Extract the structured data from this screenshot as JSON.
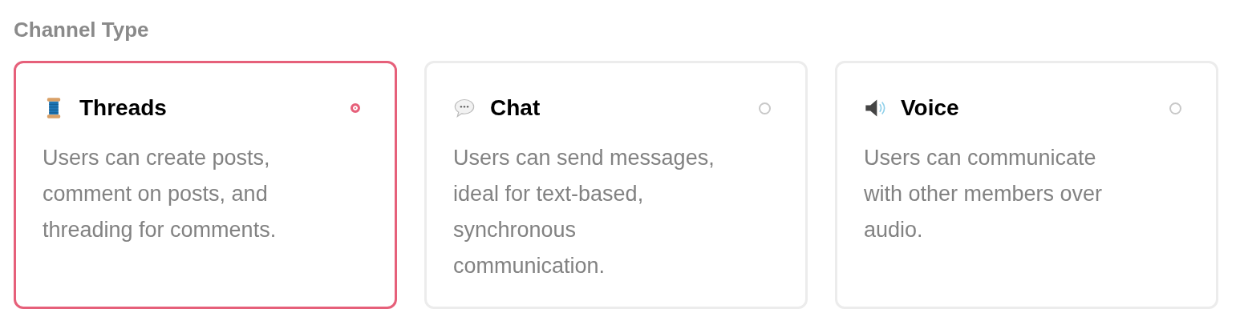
{
  "heading": "Channel Type",
  "options": [
    {
      "kind": "threads",
      "title": "Threads",
      "description": "Users can create posts,\ncomment on posts, and\nthreading for comments.",
      "selected": true
    },
    {
      "kind": "chat",
      "title": "Chat",
      "description": "Users can send messages,\nideal for text-based,\nsynchronous\ncommunication.",
      "selected": false
    },
    {
      "kind": "voice",
      "title": "Voice",
      "description": "Users can communicate\nwith other members over\naudio.",
      "selected": false
    }
  ]
}
